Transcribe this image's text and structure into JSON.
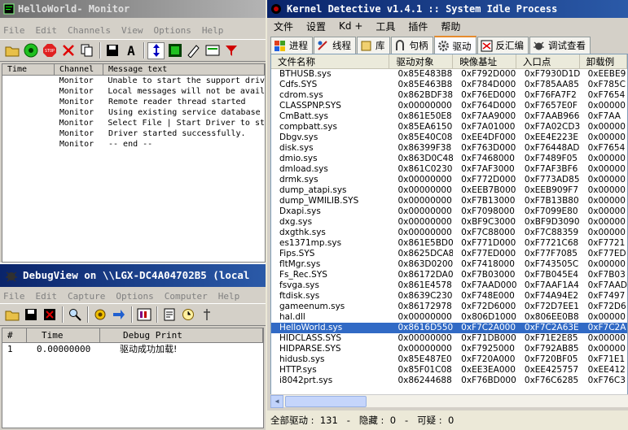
{
  "monitor": {
    "title": "HelloWorld- Monitor",
    "menu": [
      "File",
      "Edit",
      "Channels",
      "View",
      "Options",
      "Help"
    ],
    "columns": [
      "Time",
      "Channel",
      "Message text"
    ],
    "rows": [
      {
        "channel": "Monitor",
        "message": "Unable to start the support driv"
      },
      {
        "channel": "Monitor",
        "message": "Local messages will not be avail"
      },
      {
        "channel": "Monitor",
        "message": "Remote reader thread started"
      },
      {
        "channel": "Monitor",
        "message": "Using existing service database"
      },
      {
        "channel": "Monitor",
        "message": "Select File | Start Driver to st"
      },
      {
        "channel": "Monitor",
        "message": "Driver started successfully."
      },
      {
        "channel": "Monitor",
        "message": " -- end --"
      }
    ]
  },
  "debugview": {
    "title": "DebugView on \\\\LGX-DC4A04702B5 (local",
    "menu": [
      "File",
      "Edit",
      "Capture",
      "Options",
      "Computer",
      "Help"
    ],
    "columns": [
      "#",
      "Time",
      "Debug Print"
    ],
    "rows": [
      {
        "num": "1",
        "time": "0.00000000",
        "text": "驱动成功加载!"
      }
    ]
  },
  "kd": {
    "title": "Kernel Detective v1.4.1 :: System Idle Process",
    "menu": [
      "文件",
      "设置",
      "Kd +",
      "工具",
      "插件",
      "帮助"
    ],
    "tabs": [
      "进程",
      "线程",
      "库",
      "句柄",
      "驱动",
      "反汇编",
      "调试查看"
    ],
    "active_tab": "驱动",
    "columns": [
      "文件名称",
      "驱动对象",
      "映像基址",
      "入口点",
      "卸载例"
    ],
    "rows": [
      [
        "BTHUSB.sys",
        "0x85E483B8",
        "0xF792D000",
        "0xF7930D1D",
        "0xEEBE9"
      ],
      [
        "Cdfs.SYS",
        "0x85E463B8",
        "0xF784D000",
        "0xF785AA85",
        "0xF785C"
      ],
      [
        "cdrom.sys",
        "0x862BDF38",
        "0xF76ED000",
        "0xF76FA7F2",
        "0xF7654"
      ],
      [
        "CLASSPNP.SYS",
        "0x00000000",
        "0xF764D000",
        "0xF7657E0F",
        "0x00000"
      ],
      [
        "CmBatt.sys",
        "0x861E50E8",
        "0xF7AA9000",
        "0xF7AAB966",
        "0xF7AA"
      ],
      [
        "compbatt.sys",
        "0x85EA6150",
        "0xF7A01000",
        "0xF7A02CD3",
        "0x00000"
      ],
      [
        "Dbgv.sys",
        "0x85E40C08",
        "0xEE4DF000",
        "0xEE4E223E",
        "0x00000"
      ],
      [
        "disk.sys",
        "0x86399F38",
        "0xF763D000",
        "0xF76448AD",
        "0xF7654"
      ],
      [
        "dmio.sys",
        "0x863D0C48",
        "0xF7468000",
        "0xF7489F05",
        "0x00000"
      ],
      [
        "dmload.sys",
        "0x861C0230",
        "0xF7AF3000",
        "0xF7AF3BF6",
        "0x00000"
      ],
      [
        "drmk.sys",
        "0x00000000",
        "0xF772D000",
        "0xF773AD85",
        "0x00000"
      ],
      [
        "dump_atapi.sys",
        "0x00000000",
        "0xEEB7B000",
        "0xEEB909F7",
        "0x00000"
      ],
      [
        "dump_WMILIB.SYS",
        "0x00000000",
        "0xF7B13000",
        "0xF7B13B80",
        "0x00000"
      ],
      [
        "Dxapi.sys",
        "0x00000000",
        "0xF7098000",
        "0xF7099E80",
        "0x00000"
      ],
      [
        "dxg.sys",
        "0x00000000",
        "0xBF9C3000",
        "0xBF9D3090",
        "0x00000"
      ],
      [
        "dxgthk.sys",
        "0x00000000",
        "0xF7C88000",
        "0xF7C88359",
        "0x00000"
      ],
      [
        "es1371mp.sys",
        "0x861E5BD0",
        "0xF771D000",
        "0xF7721C68",
        "0xF7721"
      ],
      [
        "Fips.SYS",
        "0x8625DCA8",
        "0xF77ED000",
        "0xF77F7085",
        "0xF77ED"
      ],
      [
        "fltMgr.sys",
        "0x863D0200",
        "0xF7418000",
        "0xF743505C",
        "0x00000"
      ],
      [
        "Fs_Rec.SYS",
        "0x86172DA0",
        "0xF7B03000",
        "0xF7B045E4",
        "0xF7B03"
      ],
      [
        "fsvga.sys",
        "0x861E4578",
        "0xF7AAD000",
        "0xF7AAF1A4",
        "0xF7AAD"
      ],
      [
        "ftdisk.sys",
        "0x8639C230",
        "0xF748E000",
        "0xF74A94E2",
        "0xF7497"
      ],
      [
        "gameenum.sys",
        "0x86172978",
        "0xF72D6000",
        "0xF72D7EE1",
        "0xF72D6"
      ],
      [
        "hal.dll",
        "0x00000000",
        "0x806D1000",
        "0x806EE0B8",
        "0x00000"
      ],
      [
        "HelloWorld.sys",
        "0x8616D550",
        "0xF7C2A000",
        "0xF7C2A63E",
        "0xF7C2A"
      ],
      [
        "HIDCLASS.SYS",
        "0x00000000",
        "0xF71DB000",
        "0xF71E2E85",
        "0x00000"
      ],
      [
        "HIDPARSE.SYS",
        "0x00000000",
        "0xF7925000",
        "0xF792AB85",
        "0x00000"
      ],
      [
        "hidusb.sys",
        "0x85E487E0",
        "0xF720A000",
        "0xF720BF05",
        "0xF71E1"
      ],
      [
        "HTTP.sys",
        "0x85F01C08",
        "0xEE3EA000",
        "0xEE425757",
        "0xEE412"
      ],
      [
        "i8042prt.sys",
        "0x86244688",
        "0xF76BD000",
        "0xF76C6285",
        "0xF76C3"
      ]
    ],
    "selected_row": "HelloWorld.sys",
    "status": "全部驱动 :  131   -   隐藏 :  0   -   可疑 :  0"
  }
}
